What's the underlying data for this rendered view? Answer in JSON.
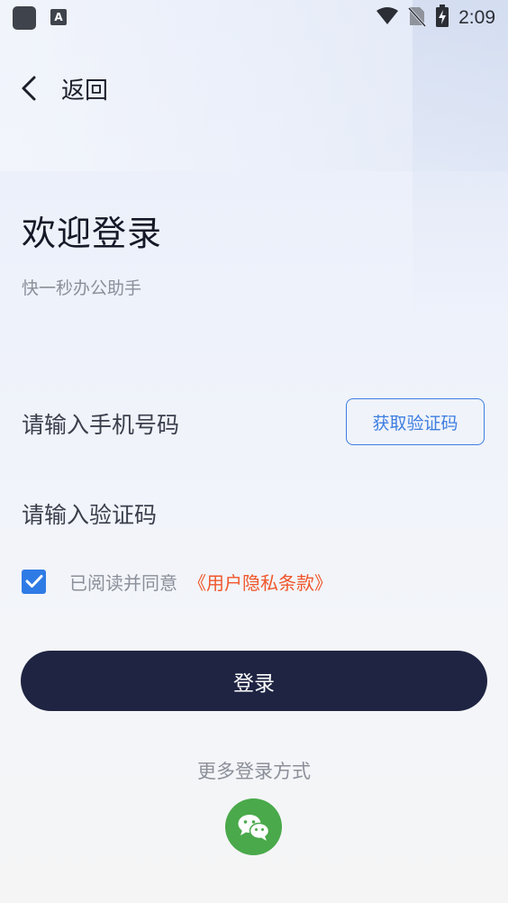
{
  "status_bar": {
    "time": "2:09",
    "left_icons": [
      "app-square-icon",
      "a-keyboard-icon"
    ],
    "right_icons": [
      "wifi-icon",
      "no-sim-icon",
      "battery-charging-icon"
    ],
    "a_glyph": "A"
  },
  "nav": {
    "back_label": "返回",
    "back_icon": "chevron-left-icon"
  },
  "header": {
    "title": "欢迎登录",
    "subtitle": "快一秒办公助手"
  },
  "form": {
    "phone_placeholder": "请输入手机号码",
    "get_code_label": "获取验证码",
    "code_placeholder": "请输入验证码"
  },
  "agreement": {
    "checked": true,
    "text": "已阅读并同意",
    "link_text": "《用户隐私条款》",
    "link_color": "#f0562b"
  },
  "actions": {
    "login_label": "登录",
    "login_color": "#1e2442"
  },
  "alt_login": {
    "label": "更多登录方式",
    "wechat_icon": "wechat-icon",
    "wechat_color": "#4aa94b"
  },
  "colors": {
    "accent": "#3d7ee0",
    "checkbox": "#2f7be5"
  }
}
